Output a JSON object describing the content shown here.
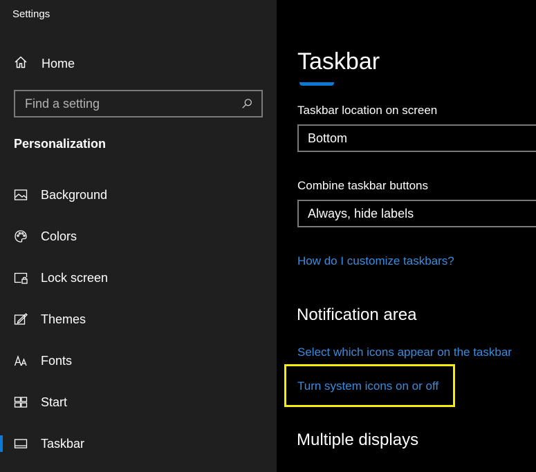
{
  "window": {
    "title": "Settings"
  },
  "sidebar": {
    "home_label": "Home",
    "search_placeholder": "Find a setting",
    "section_heading": "Personalization",
    "items": [
      {
        "label": "Background",
        "icon": "image-icon"
      },
      {
        "label": "Colors",
        "icon": "palette-icon"
      },
      {
        "label": "Lock screen",
        "icon": "lock-screen-icon"
      },
      {
        "label": "Themes",
        "icon": "themes-icon"
      },
      {
        "label": "Fonts",
        "icon": "fonts-icon"
      },
      {
        "label": "Start",
        "icon": "start-icon"
      },
      {
        "label": "Taskbar",
        "icon": "taskbar-icon",
        "active": true
      }
    ]
  },
  "main": {
    "title": "Taskbar",
    "location": {
      "label": "Taskbar location on screen",
      "value": "Bottom"
    },
    "combine": {
      "label": "Combine taskbar buttons",
      "value": "Always, hide labels"
    },
    "customize_link": "How do I customize taskbars?",
    "notification_area": {
      "heading": "Notification area",
      "select_icons_link": "Select which icons appear on the taskbar",
      "system_icons_link": "Turn system icons on or off"
    },
    "multiple_displays_heading": "Multiple displays"
  },
  "colors": {
    "accent": "#0a7ad6",
    "link": "#3a8cde",
    "highlight": "#f6ee0a",
    "sidebar_bg": "#1f1f1f",
    "main_bg": "#000000"
  }
}
